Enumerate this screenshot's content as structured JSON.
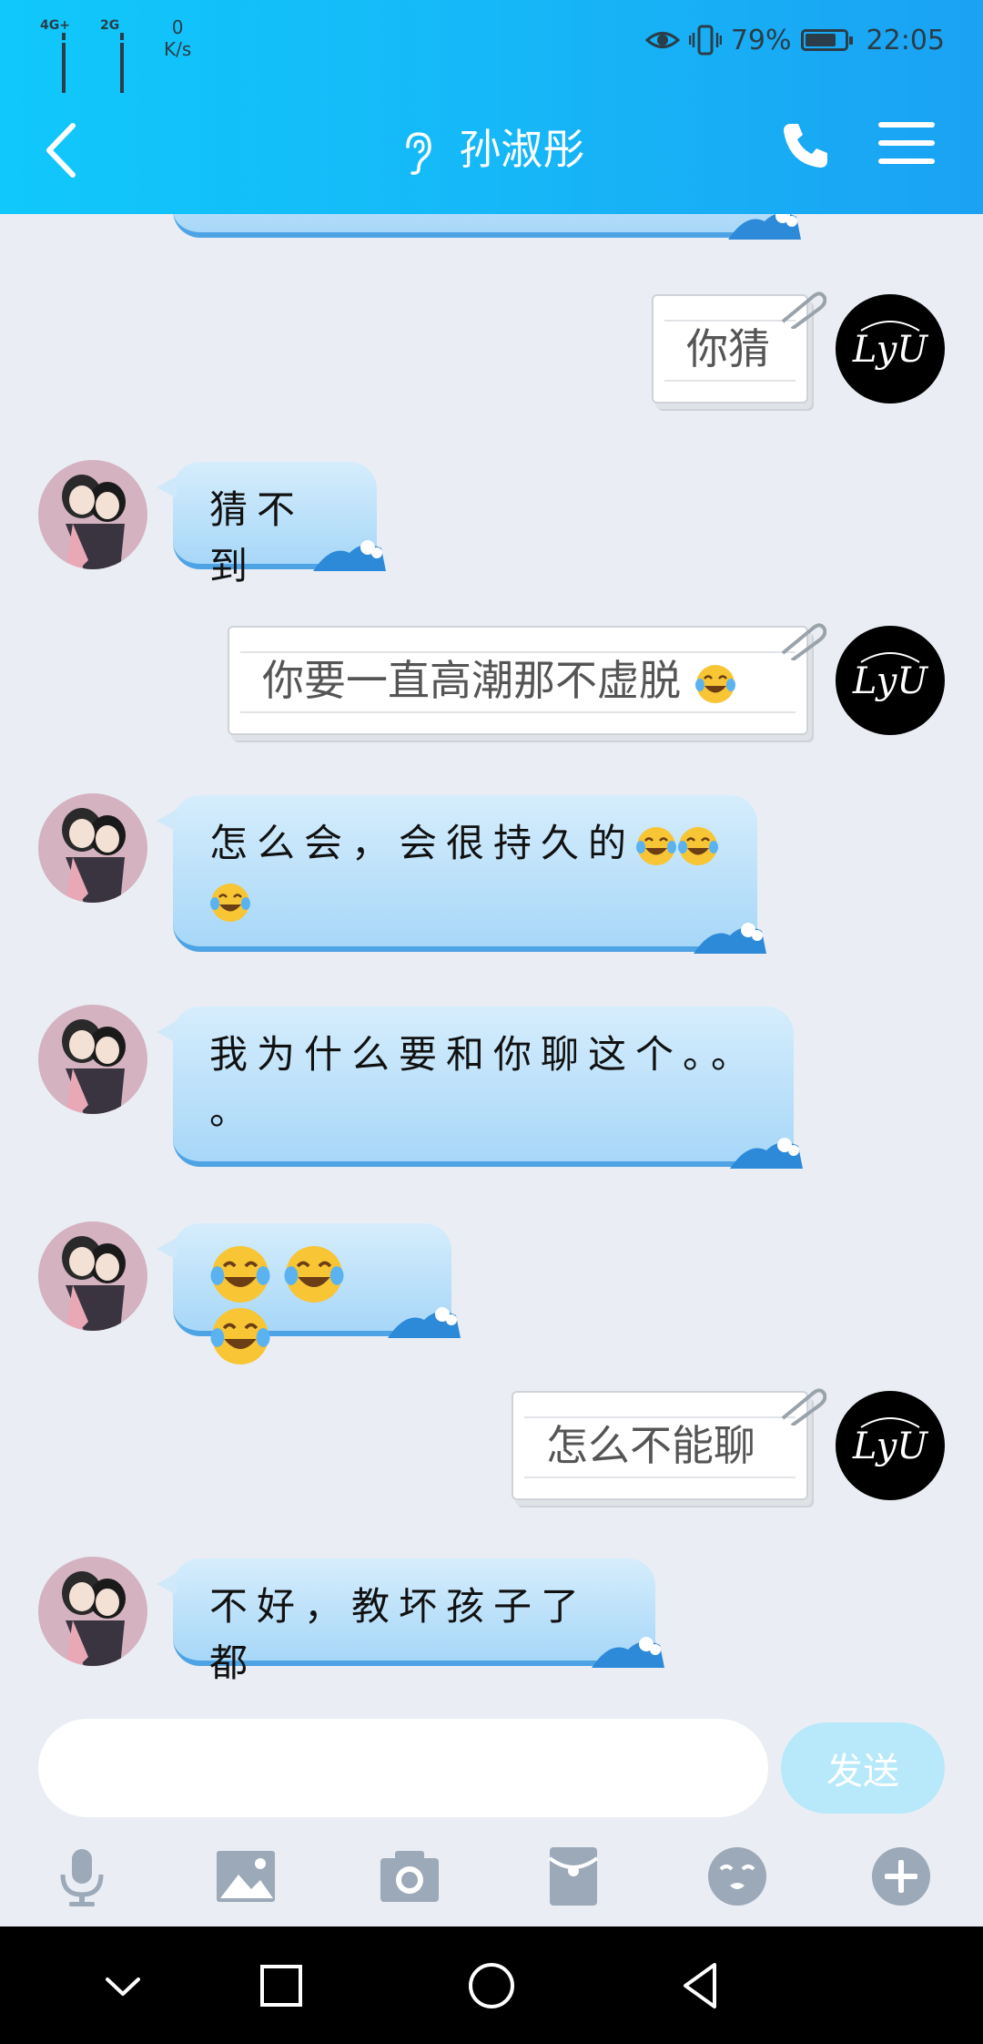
{
  "status": {
    "net1": "4G+",
    "net2": "2G",
    "speed_value": "0",
    "speed_unit": "K/s",
    "battery": "79%",
    "battery_level": 0.79,
    "time": "22:05"
  },
  "header": {
    "title": "孙淑彤"
  },
  "messages": [
    {
      "side": "left",
      "text": "猜不到"
    },
    {
      "side": "right",
      "text": "你猜"
    },
    {
      "side": "right",
      "text": "你要一直高潮那不虚脱",
      "emoji": "face-with-tears-of-joy"
    },
    {
      "side": "left",
      "text_line1": "怎么会，会很持久的",
      "emoji_count": 3
    },
    {
      "side": "left",
      "text_line1": "我为什么要和你聊这个。。",
      "text_line2": "。"
    },
    {
      "side": "left",
      "emoji": "face-with-tears-of-joy",
      "emoji_count": 3
    },
    {
      "side": "right",
      "text": "怎么不能聊"
    },
    {
      "side": "left",
      "text": "不好，教坏孩子了都"
    }
  ],
  "input": {
    "value": "",
    "send_label": "发送"
  },
  "toolbar": [
    "microphone-icon",
    "image-icon",
    "camera-icon",
    "red-packet-icon",
    "sticker-icon",
    "plus-icon"
  ],
  "colors": {
    "header": "#16b6f7",
    "bubble_left": "#a7d7f8",
    "background": "#eaedf4",
    "send_button": "#b7e9fb"
  }
}
